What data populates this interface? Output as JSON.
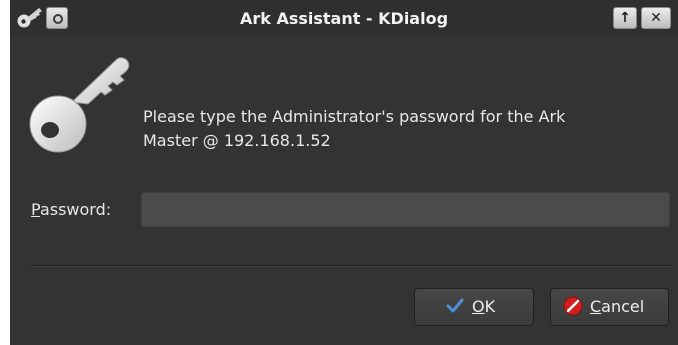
{
  "window": {
    "title": "Ark Assistant - KDialog",
    "keep_above_glyph": "↑",
    "close_glyph": "✕"
  },
  "icons": {
    "titlebar": "key-icon",
    "sticky": "sticky-pin-icon",
    "dialog": "key-icon",
    "ok": "checkmark-icon",
    "cancel": "cancel-icon"
  },
  "message": {
    "line1": "Please type the Administrator's password for the Ark",
    "line2": "Master @ 192.168.1.52"
  },
  "password": {
    "label_mnemonic": "P",
    "label_rest": "assword:",
    "value": ""
  },
  "buttons": {
    "ok_mnemonic": "O",
    "ok_rest": "K",
    "cancel_mnemonic": "C",
    "cancel_rest": "ancel"
  },
  "colors": {
    "background": "#333333",
    "input": "#4b4b4b",
    "text": "#e8e8e8",
    "ok_check": "#4a90d9",
    "cancel_red": "#d11e1e"
  }
}
